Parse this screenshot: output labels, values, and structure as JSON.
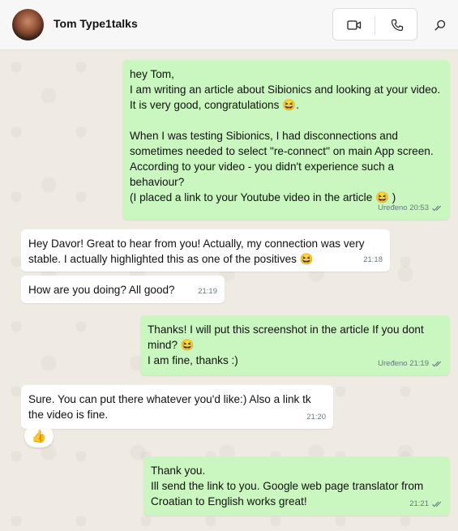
{
  "header": {
    "contact_name": "Tom Type1talks",
    "icons": {
      "video": "video-call-icon",
      "voice": "voice-call-icon",
      "search": "search-icon"
    }
  },
  "messages": [
    {
      "direction": "out",
      "text": "hey Tom,\nI am writing an article about Sibionics and looking at your video. It is very good, congratulations 😆.\n\nWhen I was testing Sibionics, I had disconnections and sometimes needed to select \"re-connect\" on main App screen. According to your video - you didn't experience such a behaviour?\n(I placed a link to your Youtube video in the article 😆 )",
      "meta": "Uređeno 20:53"
    },
    {
      "direction": "in",
      "text": "Hey Davor! Great to hear from you! Actually, my connection was very stable. I actually highlighted this as one of the positives 😆",
      "meta": "21:18"
    },
    {
      "direction": "in",
      "text": "How are you doing? All good?",
      "meta": "21:19"
    },
    {
      "direction": "out",
      "text": "Thanks! I will put this screenshot in the article If you dont mind? 😆\nI am fine, thanks :)",
      "meta": "Uređeno 21:19"
    },
    {
      "direction": "in",
      "text": "Sure. You can put there whatever you'd like:) Also a link tk the video is fine.",
      "meta": "21:20",
      "reaction": "👍"
    },
    {
      "direction": "out",
      "text": "Thank you.\nIll send the link to you. Google web page translator from Croatian to English works great!",
      "meta": "21:21"
    }
  ],
  "colors": {
    "outgoing_bubble": "#c9f7bf",
    "incoming_bubble": "#ffffff",
    "chat_background": "#efeae2",
    "read_tick": "#667781"
  }
}
